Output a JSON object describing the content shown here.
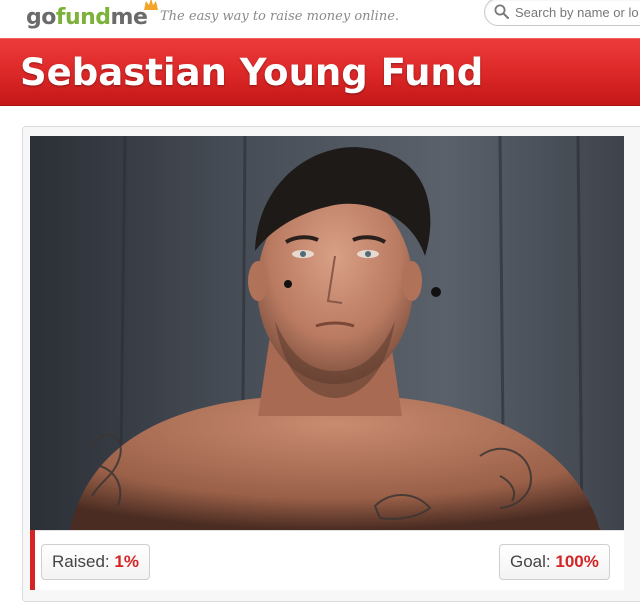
{
  "header": {
    "logo": {
      "part1": "go",
      "part2": "fund",
      "part3": "me"
    },
    "tagline": "The easy way to raise money online.",
    "search": {
      "placeholder": "Search by name or lo"
    }
  },
  "campaign": {
    "title": "Sebastian Young Fund",
    "raised_label": "Raised:",
    "raised_value": "1%",
    "goal_label": "Goal:",
    "goal_value": "100%",
    "progress_fraction": 0.01
  },
  "colors": {
    "brand_red": "#d42424",
    "logo_green": "#7cb23a",
    "logo_gray": "#6b6b6b"
  },
  "icons": [
    "search-icon",
    "logo-badge-icon"
  ]
}
